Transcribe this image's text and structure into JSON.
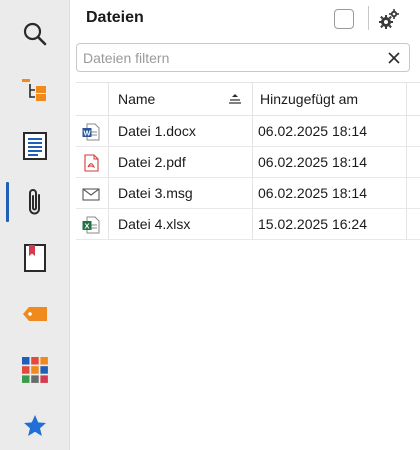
{
  "sidebar": {
    "items": [
      {
        "icon": "search-icon"
      },
      {
        "icon": "tree-structure-icon"
      },
      {
        "icon": "document-lines-icon"
      },
      {
        "icon": "paperclip-icon",
        "active": true
      },
      {
        "icon": "bookmark-book-icon"
      },
      {
        "icon": "tag-icon"
      },
      {
        "icon": "tiles-grid-icon"
      },
      {
        "icon": "star-icon"
      }
    ],
    "colors": {
      "accent": "#1f5fb5",
      "orange": "#f08a1c",
      "bookmark": "#d43a4e",
      "star": "#1f6fd6"
    }
  },
  "panel": {
    "title": "Dateien"
  },
  "filter": {
    "placeholder": "Dateien filtern",
    "value": ""
  },
  "table": {
    "columns": [
      "Name",
      "Hinzugefügt am"
    ],
    "rows": [
      {
        "icon": "word-file-icon",
        "name": "Datei 1.docx",
        "added": "06.02.2025 18:14"
      },
      {
        "icon": "pdf-file-icon",
        "name": "Datei 2.pdf",
        "added": "06.02.2025 18:14"
      },
      {
        "icon": "mail-file-icon",
        "name": "Datei 3.msg",
        "added": "06.02.2025 18:14"
      },
      {
        "icon": "excel-file-icon",
        "name": "Datei 4.xlsx",
        "added": "15.02.2025 16:24"
      }
    ]
  }
}
